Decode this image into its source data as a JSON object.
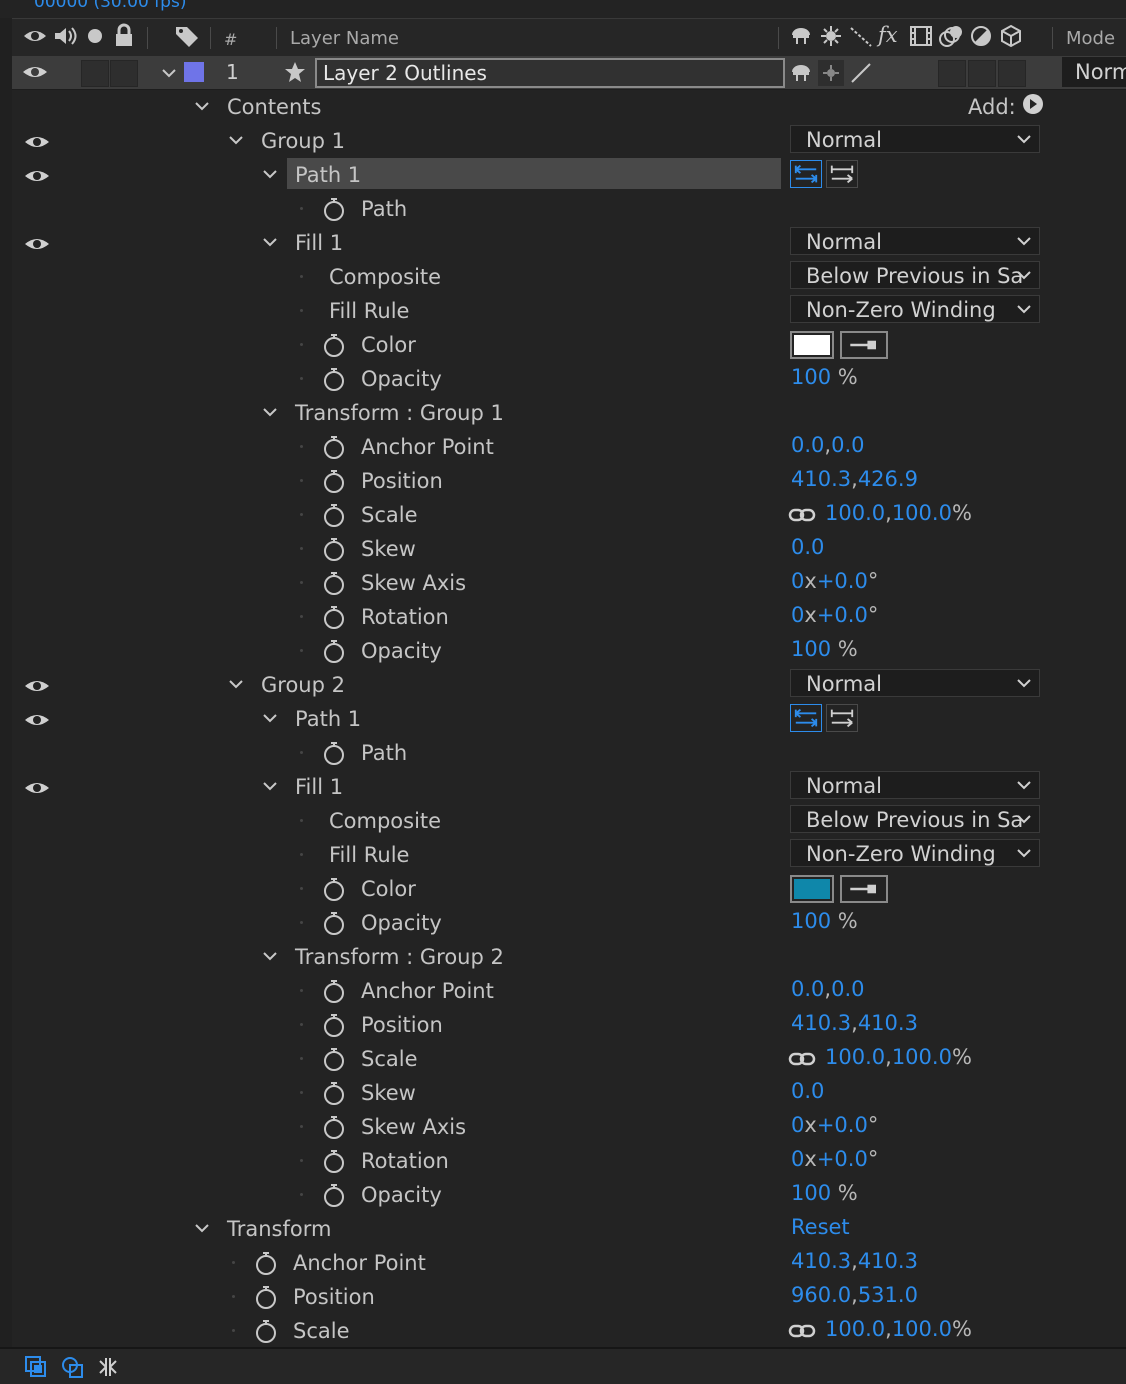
{
  "timecode": "00000 (30.00 fps)",
  "header": {
    "hash": "#",
    "layer_name": "Layer Name",
    "mode": "Mode"
  },
  "layer": {
    "number": "1",
    "name": "Layer 2 Outlines",
    "mode": "Norm",
    "label_color": "#6f74e8"
  },
  "add_label": "Add:",
  "rows": {
    "contents": "Contents",
    "group1": {
      "name": "Group 1",
      "mode": "Normal"
    },
    "g1_path1": "Path 1",
    "g1_path": "Path",
    "g1_fill1": {
      "name": "Fill 1",
      "mode": "Normal"
    },
    "g1_composite": {
      "name": "Composite",
      "value": "Below Previous in Sa"
    },
    "g1_fillrule": {
      "name": "Fill Rule",
      "value": "Non-Zero Winding"
    },
    "g1_color": {
      "name": "Color",
      "value": "#ffffff"
    },
    "g1_opacity": {
      "name": "Opacity",
      "value": "100",
      "unit": "%"
    },
    "g1_transform": "Transform : Group 1",
    "g1_anchor": {
      "name": "Anchor Point",
      "x": "0.0",
      "y": "0.0"
    },
    "g1_position": {
      "name": "Position",
      "x": "410.3",
      "y": "426.9"
    },
    "g1_scale": {
      "name": "Scale",
      "x": "100.0",
      "y": "100.0",
      "unit": "%"
    },
    "g1_skew": {
      "name": "Skew",
      "value": "0.0"
    },
    "g1_skewaxis": {
      "name": "Skew Axis",
      "rev": "0",
      "x": "x",
      "deg": "+0.0",
      "unit": "°"
    },
    "g1_rotation": {
      "name": "Rotation",
      "rev": "0",
      "x": "x",
      "deg": "+0.0",
      "unit": "°"
    },
    "g1_topacity": {
      "name": "Opacity",
      "value": "100",
      "unit": "%"
    },
    "group2": {
      "name": "Group 2",
      "mode": "Normal"
    },
    "g2_path1": "Path 1",
    "g2_path": "Path",
    "g2_fill1": {
      "name": "Fill 1",
      "mode": "Normal"
    },
    "g2_composite": {
      "name": "Composite",
      "value": "Below Previous in Sa"
    },
    "g2_fillrule": {
      "name": "Fill Rule",
      "value": "Non-Zero Winding"
    },
    "g2_color": {
      "name": "Color",
      "value": "#0f87aa"
    },
    "g2_opacity": {
      "name": "Opacity",
      "value": "100",
      "unit": "%"
    },
    "g2_transform": "Transform : Group 2",
    "g2_anchor": {
      "name": "Anchor Point",
      "x": "0.0",
      "y": "0.0"
    },
    "g2_position": {
      "name": "Position",
      "x": "410.3",
      "y": "410.3"
    },
    "g2_scale": {
      "name": "Scale",
      "x": "100.0",
      "y": "100.0",
      "unit": "%"
    },
    "g2_skew": {
      "name": "Skew",
      "value": "0.0"
    },
    "g2_skewaxis": {
      "name": "Skew Axis",
      "rev": "0",
      "x": "x",
      "deg": "+0.0",
      "unit": "°"
    },
    "g2_rotation": {
      "name": "Rotation",
      "rev": "0",
      "x": "x",
      "deg": "+0.0",
      "unit": "°"
    },
    "g2_topacity": {
      "name": "Opacity",
      "value": "100",
      "unit": "%"
    },
    "transform": {
      "name": "Transform",
      "reset": "Reset"
    },
    "t_anchor": {
      "name": "Anchor Point",
      "x": "410.3",
      "y": "410.3"
    },
    "t_position": {
      "name": "Position",
      "x": "960.0",
      "y": "531.0"
    },
    "t_scale": {
      "name": "Scale",
      "x": "100.0",
      "y": "100.0",
      "unit": "%"
    }
  },
  "colors": {
    "accent_value": "#2d8ceb",
    "panel_bg": "#232323",
    "selected_row": "#494949"
  }
}
